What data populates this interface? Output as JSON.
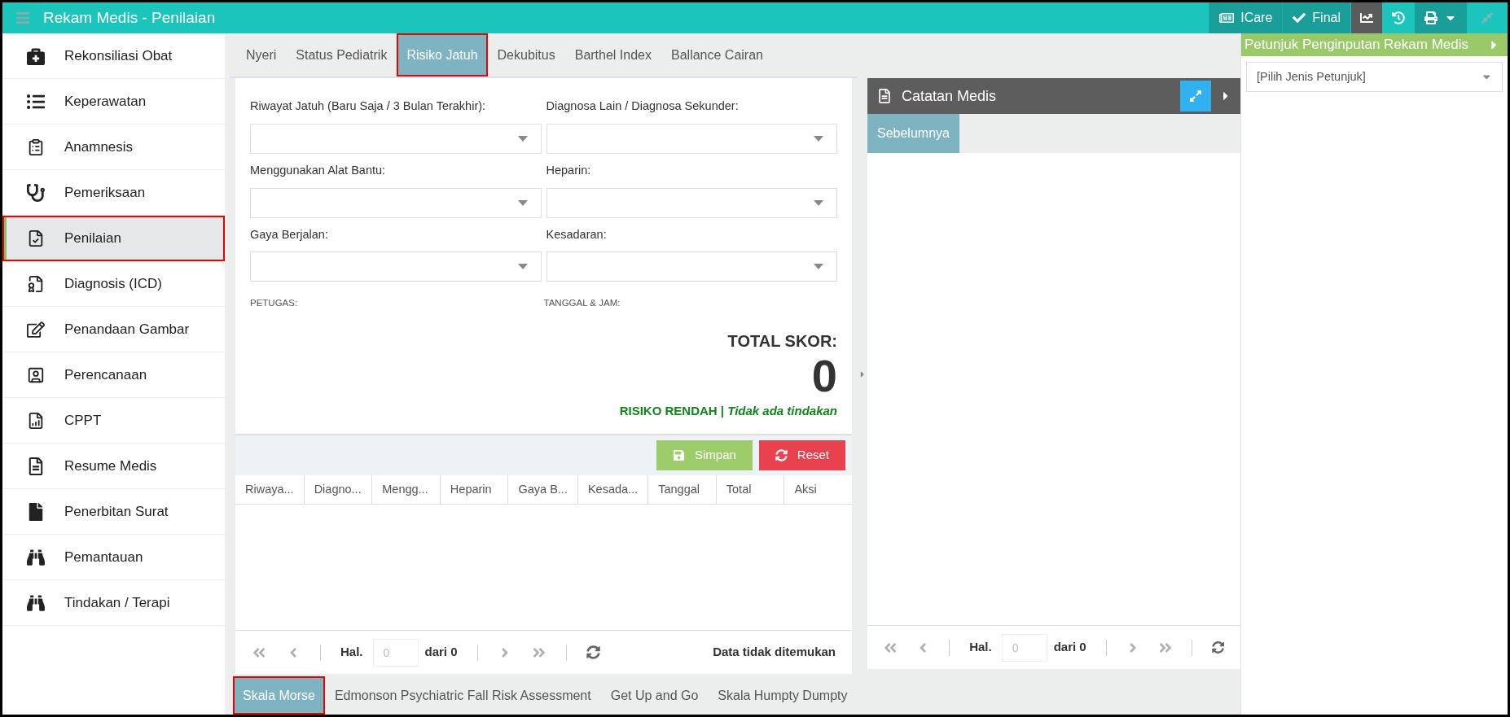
{
  "header": {
    "title": "Rekam Medis - Penilaian",
    "buttons": [
      {
        "label": "ICare",
        "kind": "icare"
      },
      {
        "label": "Final",
        "kind": "final"
      }
    ]
  },
  "sidebar": {
    "items": [
      {
        "label": "Rekonsiliasi Obat",
        "selected": false
      },
      {
        "label": "Keperawatan",
        "selected": false
      },
      {
        "label": "Anamnesis",
        "selected": false
      },
      {
        "label": "Pemeriksaan",
        "selected": false
      },
      {
        "label": "Penilaian",
        "selected": true
      },
      {
        "label": "Diagnosis (ICD)",
        "selected": false
      },
      {
        "label": "Penandaan Gambar",
        "selected": false
      },
      {
        "label": "Perencanaan",
        "selected": false
      },
      {
        "label": "CPPT",
        "selected": false
      },
      {
        "label": "Resume Medis",
        "selected": false
      },
      {
        "label": "Penerbitan Surat",
        "selected": false
      },
      {
        "label": "Pemantauan",
        "selected": false
      },
      {
        "label": "Tindakan / Terapi",
        "selected": false
      }
    ]
  },
  "tabs": [
    {
      "label": "Nyeri",
      "selected": false
    },
    {
      "label": "Status Pediatrik",
      "selected": false
    },
    {
      "label": "Risiko Jatuh",
      "selected": true
    },
    {
      "label": "Dekubitus",
      "selected": false
    },
    {
      "label": "Barthel Index",
      "selected": false
    },
    {
      "label": "Ballance Cairan",
      "selected": false
    }
  ],
  "form": {
    "fields": [
      {
        "label": "Riwayat Jatuh (Baru Saja / 3 Bulan Terakhir):"
      },
      {
        "label": "Diagnosa Lain / Diagnosa Sekunder:"
      },
      {
        "label": "Menggunakan Alat Bantu:"
      },
      {
        "label": "Heparin:"
      },
      {
        "label": "Gaya Berjalan:"
      },
      {
        "label": "Kesadaran:"
      }
    ],
    "petugas_label": "PETUGAS:",
    "tanggal_label": "TANGGAL & JAM:",
    "total_label": "TOTAL SKOR:",
    "total_value": "0",
    "risk": "RISIKO RENDAH | *Tidak ada tindakan*"
  },
  "toolbar": {
    "buttons": [
      {
        "label": "Simpan",
        "kind": "save"
      },
      {
        "label": "Reset",
        "kind": "reset"
      }
    ]
  },
  "table": {
    "columns": [
      "Riwaya...",
      "Diagno...",
      "Mengg...",
      "Heparin",
      "Gaya B...",
      "Kesada...",
      "Tanggal",
      "Total",
      "Aksi"
    ]
  },
  "pager": {
    "page_label": "Hal.",
    "placeholder": "0",
    "total": "dari 0",
    "status": "Data tidak ditemukan"
  },
  "notes_panel": {
    "title": "Catatan Medis",
    "tabs": [
      {
        "label": "Sebelumnya",
        "selected": true
      }
    ],
    "pager": {
      "page_label": "Hal.",
      "placeholder": "0",
      "total": "dari 0"
    }
  },
  "guide": {
    "title": "Petunjuk Penginputan Rekam Medis",
    "select": {
      "value": "[Pilih Jenis Petunjuk]"
    }
  },
  "bottom_tabs": [
    {
      "label": "Skala Morse",
      "selected": true
    },
    {
      "label": "Edmonson Psychiatric Fall Risk Assessment",
      "selected": false
    },
    {
      "label": "Get Up and Go",
      "selected": false
    },
    {
      "label": "Skala Humpty Dumpty",
      "selected": false
    }
  ]
}
